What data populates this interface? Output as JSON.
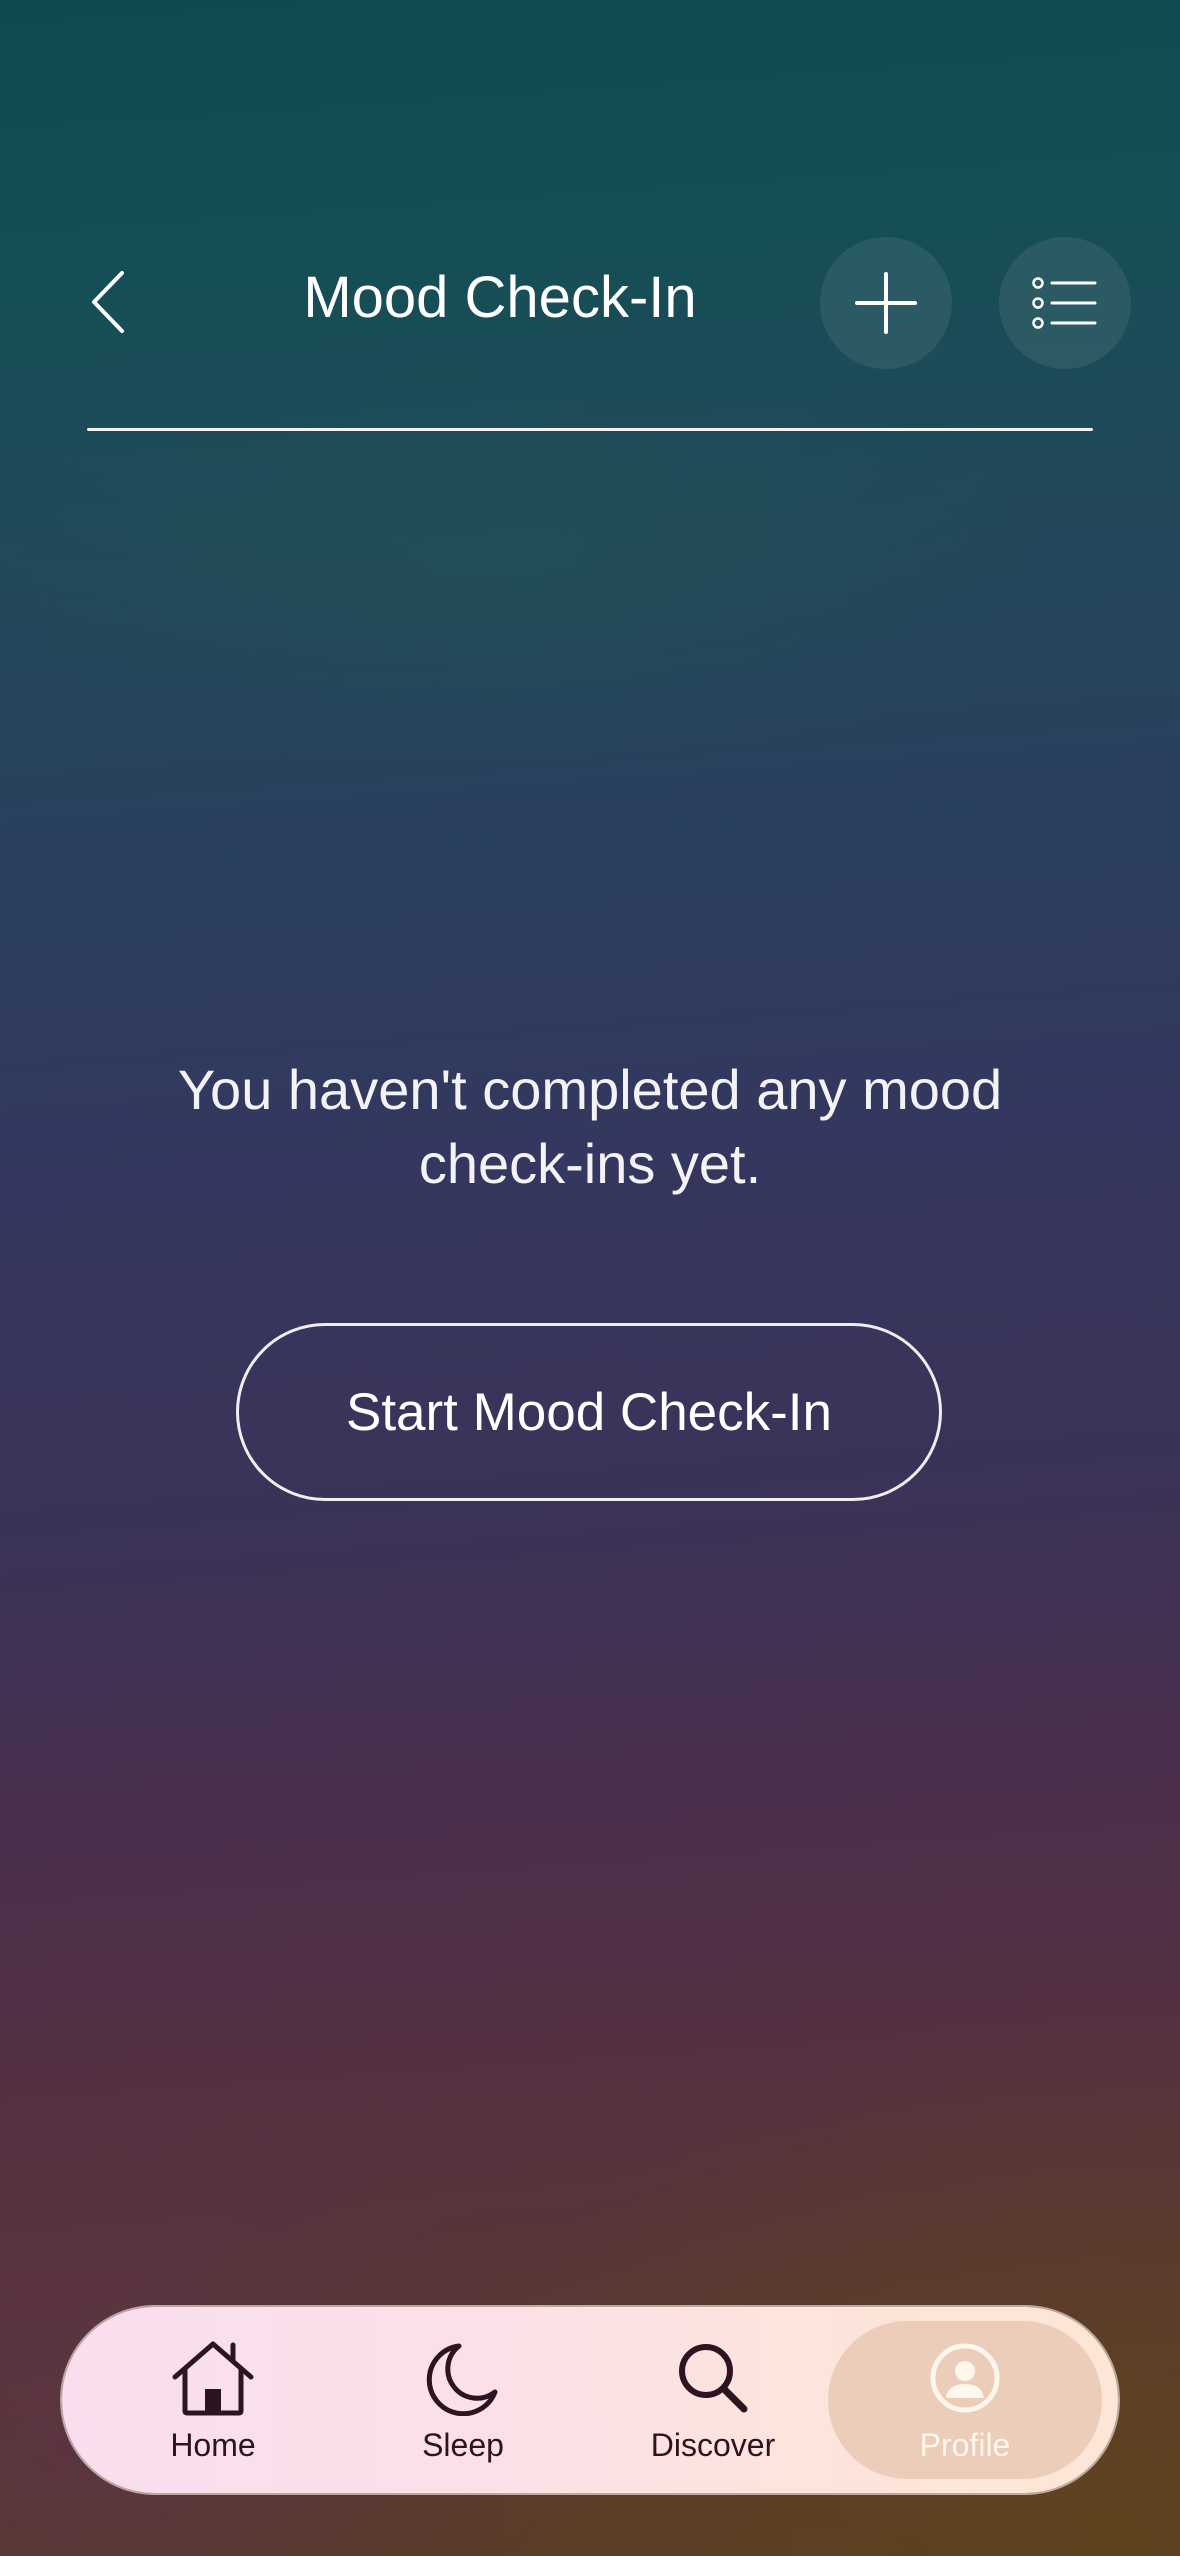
{
  "header": {
    "title": "Mood Check-In",
    "back_icon": "chevron-left-icon",
    "add_icon": "plus-icon",
    "list_icon": "list-icon"
  },
  "empty_state": {
    "message": "You haven't completed any mood check-ins yet.",
    "start_button_label": "Start Mood Check-In"
  },
  "bottom_nav": {
    "items": [
      {
        "label": "Home",
        "icon": "home-icon",
        "active": false
      },
      {
        "label": "Sleep",
        "icon": "moon-icon",
        "active": false
      },
      {
        "label": "Discover",
        "icon": "search-icon",
        "active": false
      },
      {
        "label": "Profile",
        "icon": "user-circle-icon",
        "active": true
      }
    ]
  },
  "colors": {
    "background_top": "#0e4a4f",
    "background_mid": "#34375f",
    "background_bottom": "#5b3d24",
    "nav_bg": "#fbe0e8",
    "nav_active_bg": "#ebcdb9",
    "nav_icon": "#2a1520"
  }
}
